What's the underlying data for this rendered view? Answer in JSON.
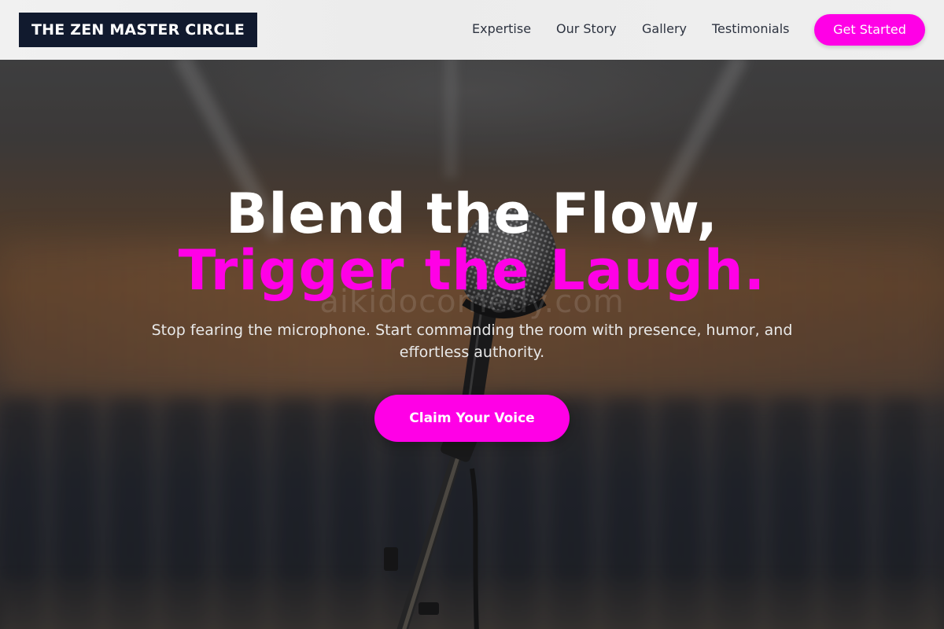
{
  "brand": {
    "name": "THE ZEN MASTER CIRCLE"
  },
  "nav": {
    "links": [
      {
        "label": "Expertise"
      },
      {
        "label": "Our Story"
      },
      {
        "label": "Gallery"
      },
      {
        "label": "Testimonials"
      }
    ],
    "cta_label": "Get Started"
  },
  "hero": {
    "title_line1": "Blend the Flow,",
    "title_line2": "Trigger the Laugh.",
    "subtitle": "Stop fearing the microphone. Start commanding the room with presence, humor, and effortless authority.",
    "cta_label": "Claim Your Voice",
    "watermark": "aikidocomedy.com"
  },
  "colors": {
    "accent": "#ff00e6",
    "brand_bg": "#111a2e",
    "nav_bg": "#efefef"
  },
  "icons": {
    "background_image": "microphone-on-stand"
  }
}
